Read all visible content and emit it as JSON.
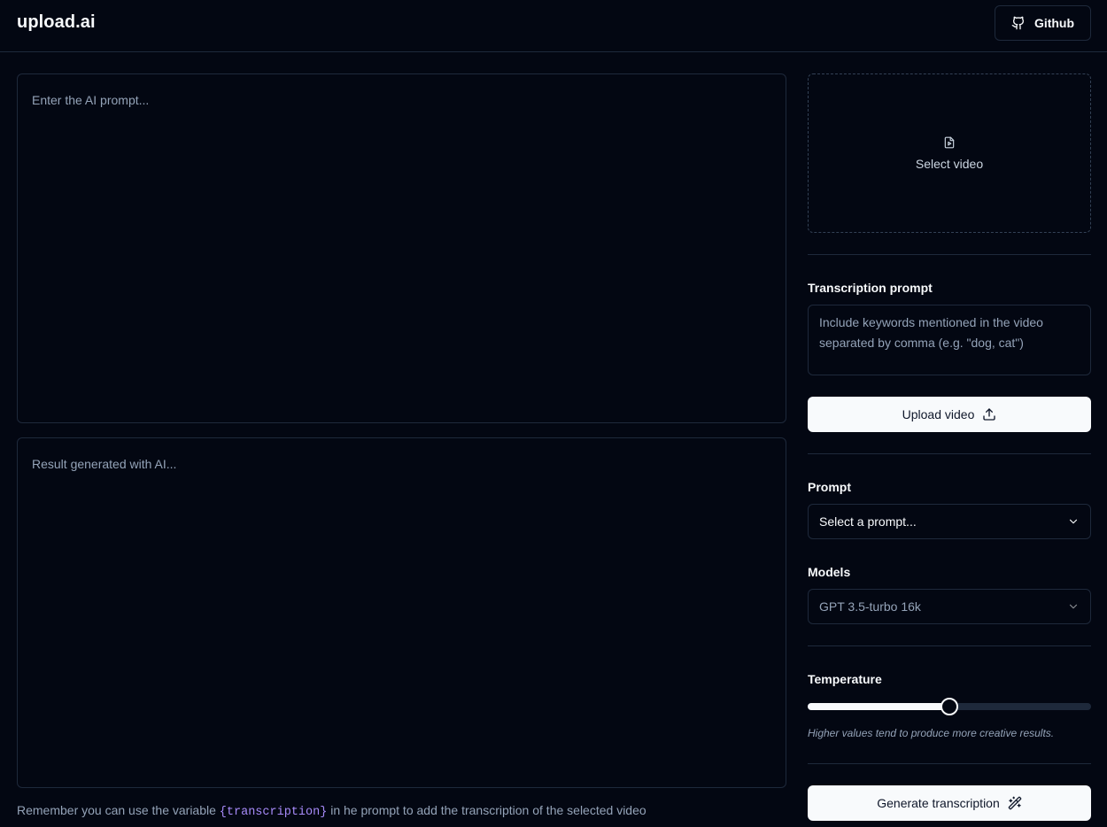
{
  "header": {
    "logo": "upload.ai",
    "github_label": "Github"
  },
  "main": {
    "prompt_placeholder": "Enter the AI prompt...",
    "result_placeholder": "Result generated with AI...",
    "hint_before": "Remember you can use the variable ",
    "hint_variable": "{transcription}",
    "hint_after": " in he prompt to add the transcription of the selected video"
  },
  "sidebar": {
    "dropzone_label": "Select video",
    "transcription_label": "Transcription prompt",
    "transcription_placeholder": "Include keywords mentioned in the video separated by comma (e.g. \"dog, cat\")",
    "upload_label": "Upload video",
    "prompt_label": "Prompt",
    "prompt_select_value": "Select a prompt...",
    "models_label": "Models",
    "models_select_value": "GPT 3.5-turbo 16k",
    "temperature_label": "Temperature",
    "temperature_value": 0.5,
    "temperature_note": "Higher values tend to produce more creative results.",
    "generate_label": "Generate transcription"
  },
  "icons": {
    "github": "github-icon",
    "file_video": "file-video-icon",
    "upload": "upload-icon",
    "chevron": "chevron-down-icon",
    "wand": "wand-icon"
  }
}
